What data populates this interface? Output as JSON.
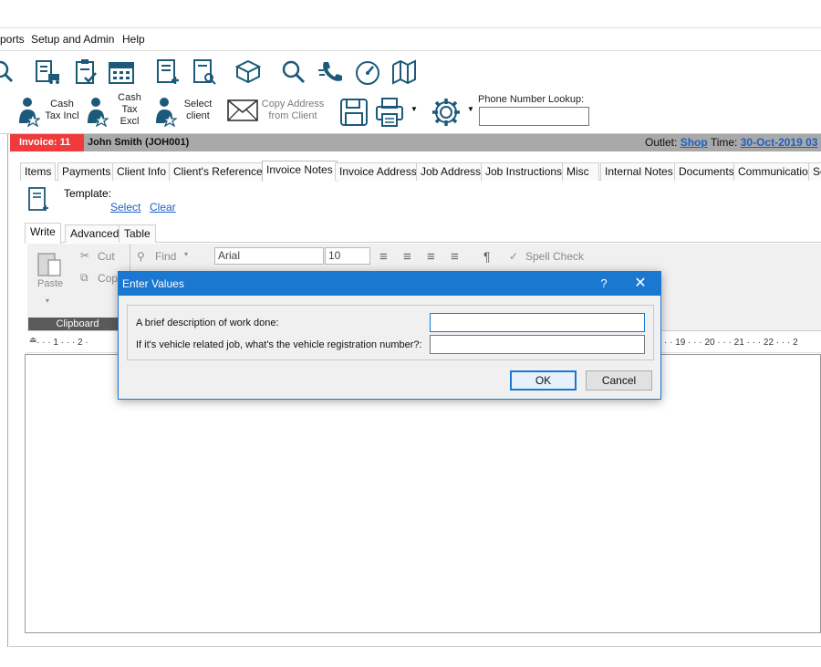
{
  "menu": {
    "items": [
      "ports",
      "Setup and Admin",
      "Help"
    ]
  },
  "toolbar": {
    "cash_tax_incl": [
      "Cash",
      "Tax Incl"
    ],
    "cash_tax_excl": [
      "Cash",
      "Tax",
      "Excl"
    ],
    "select_client": [
      "Select",
      "client"
    ],
    "copy_address": [
      "Copy Address",
      "from Client"
    ],
    "phone_lookup_label": "Phone Number Lookup:",
    "phone_lookup_value": ""
  },
  "invoice": {
    "number_label": "Invoice: 11",
    "client": "John Smith (JOH001)",
    "outlet_label": "Outlet:",
    "outlet_value": "Shop",
    "time_label": "Time:",
    "time_value": "30-Oct-2019 03"
  },
  "tabs": [
    "Items",
    "Payments",
    "Client Info",
    "Client's References",
    "Invoice Notes",
    "Invoice Address",
    "Job Address",
    "Job Instructions",
    "Misc",
    "Internal Notes",
    "Documents",
    "Communication",
    "Se"
  ],
  "active_tab": "Invoice Notes",
  "template": {
    "label": "Template:",
    "select": "Select",
    "clear": "Clear"
  },
  "subtabs": [
    "Write",
    "Advanced",
    "Table"
  ],
  "ribbon": {
    "paste": "Paste",
    "cut": "Cut",
    "copy": "Cop",
    "find": "Find",
    "font": "Arial",
    "size": "10",
    "pilcrow": "¶",
    "spell_check": "Spell Check",
    "clipboard_group": "Clipboard"
  },
  "ruler": {
    "left_ticks": "· · · 1 · · · 2 ·",
    "right_ticks": "· · 19 · · · 20 · · · 21 · · · 22 · · · 2"
  },
  "dialog": {
    "title": "Enter Values",
    "help": "?",
    "close": "✕",
    "field1_label": "A brief description of work done:",
    "field1_value": "",
    "field2_label": "If it's vehicle related job, what's the vehicle registration number?:",
    "field2_value": "",
    "ok": "OK",
    "cancel": "Cancel"
  },
  "colors": {
    "accent": "#1b78d0",
    "invoice_red": "#ef3b3b",
    "link": "#1f5fc4"
  }
}
